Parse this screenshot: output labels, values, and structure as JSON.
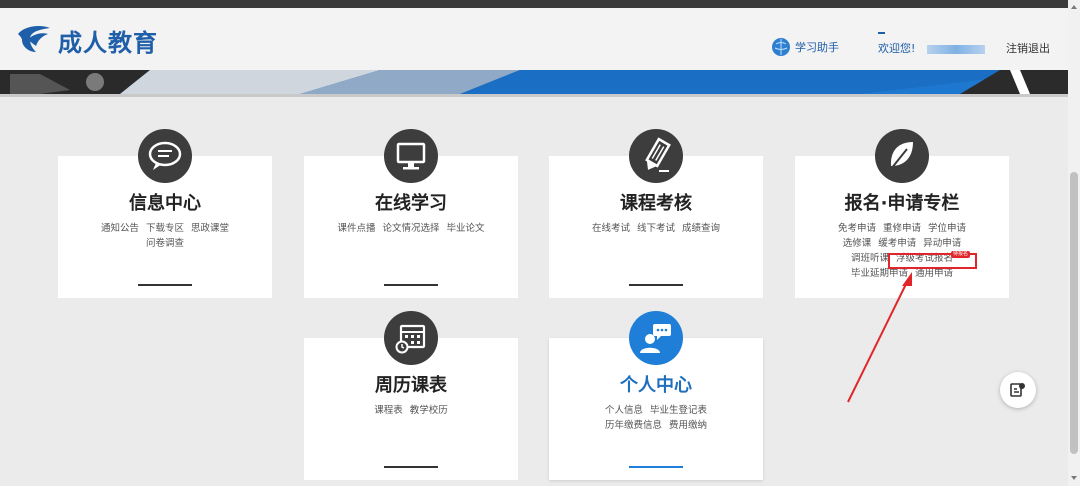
{
  "header": {
    "brand": "成人教育",
    "helper_label": "学习助手",
    "welcome_label": "欢迎您!",
    "logout_label": "注销退出"
  },
  "cards": {
    "info": {
      "title": "信息中心",
      "links": [
        "通知公告",
        "下载专区",
        "思政课堂",
        "问卷调查"
      ]
    },
    "online": {
      "title": "在线学习",
      "links": [
        "课件点播",
        "论文情况选择",
        "毕业论文"
      ]
    },
    "exam": {
      "title": "课程考核",
      "links": [
        "在线考试",
        "线下考试",
        "成绩查询"
      ]
    },
    "apply": {
      "title": "报名·申请专栏",
      "links": [
        "免考申请",
        "重修申请",
        "学位申请",
        "选修课",
        "缓考申请",
        "异动申请",
        "调班听课",
        "浮级考试报名",
        "毕业延期申请",
        "通用申请"
      ]
    },
    "calendar": {
      "title": "周历课表",
      "links": [
        "课程表",
        "教学校历"
      ]
    },
    "personal": {
      "title": "个人中心",
      "links": [
        "个人信息",
        "毕业生登记表",
        "历年缴费信息",
        "费用缴纳"
      ]
    }
  },
  "highlight": {
    "badge": "待报名",
    "color": "#e0262a"
  },
  "colors": {
    "brand": "#1f5ea8",
    "accent": "#1f7fd8",
    "icon_dark": "#3d3d3d"
  },
  "icons": [
    "chat-bubbles-icon",
    "monitor-icon",
    "pencil-icon",
    "leaf-icon",
    "calendar-clock-icon",
    "user-chat-icon",
    "globe-icon",
    "chat-assist-icon"
  ]
}
